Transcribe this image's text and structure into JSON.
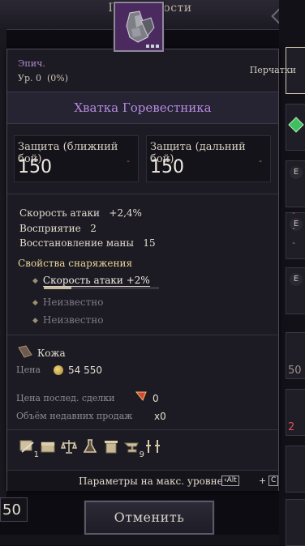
{
  "background": {
    "title": "Подробности",
    "side_number": "50",
    "right_slot_numbers": [
      "50",
      "2"
    ],
    "right_slot_letter": "E",
    "cancel_label": "Отменить"
  },
  "item": {
    "rarity": "Эпич.",
    "level": "Ур. 0",
    "level_progress": "(0%)",
    "slot_type": "Перчатки",
    "name": "Хватка Горевестника",
    "rarity_color": "#b68ae0"
  },
  "defense": {
    "melee_label": "Защита (ближний бой)",
    "melee_value": "150",
    "melee_change": "-",
    "ranged_label": "Защита (дальний бой)",
    "ranged_value": "150",
    "ranged_change": "-"
  },
  "stats": [
    {
      "label": "Скорость атаки",
      "value": "+2,4%",
      "change": "-",
      "change_color": "#d65050"
    },
    {
      "label": "Восприятие",
      "value": "2",
      "change": "-",
      "change_color": "#5ac05a"
    },
    {
      "label": "Восстановление маны",
      "value": "15",
      "change": "-",
      "change_color": "#5ac05a"
    }
  ],
  "properties": {
    "title": "Свойства снаряжения",
    "items": [
      {
        "label": "Скорость атаки +2%",
        "progress": 0.24
      },
      {
        "label": "Неизвестно"
      },
      {
        "label": "Неизвестно"
      }
    ]
  },
  "material": "Кожа",
  "price": {
    "label": "Цена",
    "value": "54 550"
  },
  "last_trade": {
    "label": "Цена послед. сделки",
    "value": "0"
  },
  "recent_volume": {
    "label": "Объём недавних продаж",
    "value": "x0"
  },
  "actions": [
    {
      "icon": "scroll-icon",
      "count": "1"
    },
    {
      "icon": "chest-icon"
    },
    {
      "icon": "scales-icon"
    },
    {
      "icon": "flask-icon"
    },
    {
      "icon": "trash-icon"
    },
    {
      "icon": "anvil-icon",
      "count": "9"
    },
    {
      "icon": "swords-icon"
    }
  ],
  "footer": {
    "text": "Параметры на макс. уровне",
    "key1": "Alt",
    "plus": "+",
    "key2": "C"
  }
}
